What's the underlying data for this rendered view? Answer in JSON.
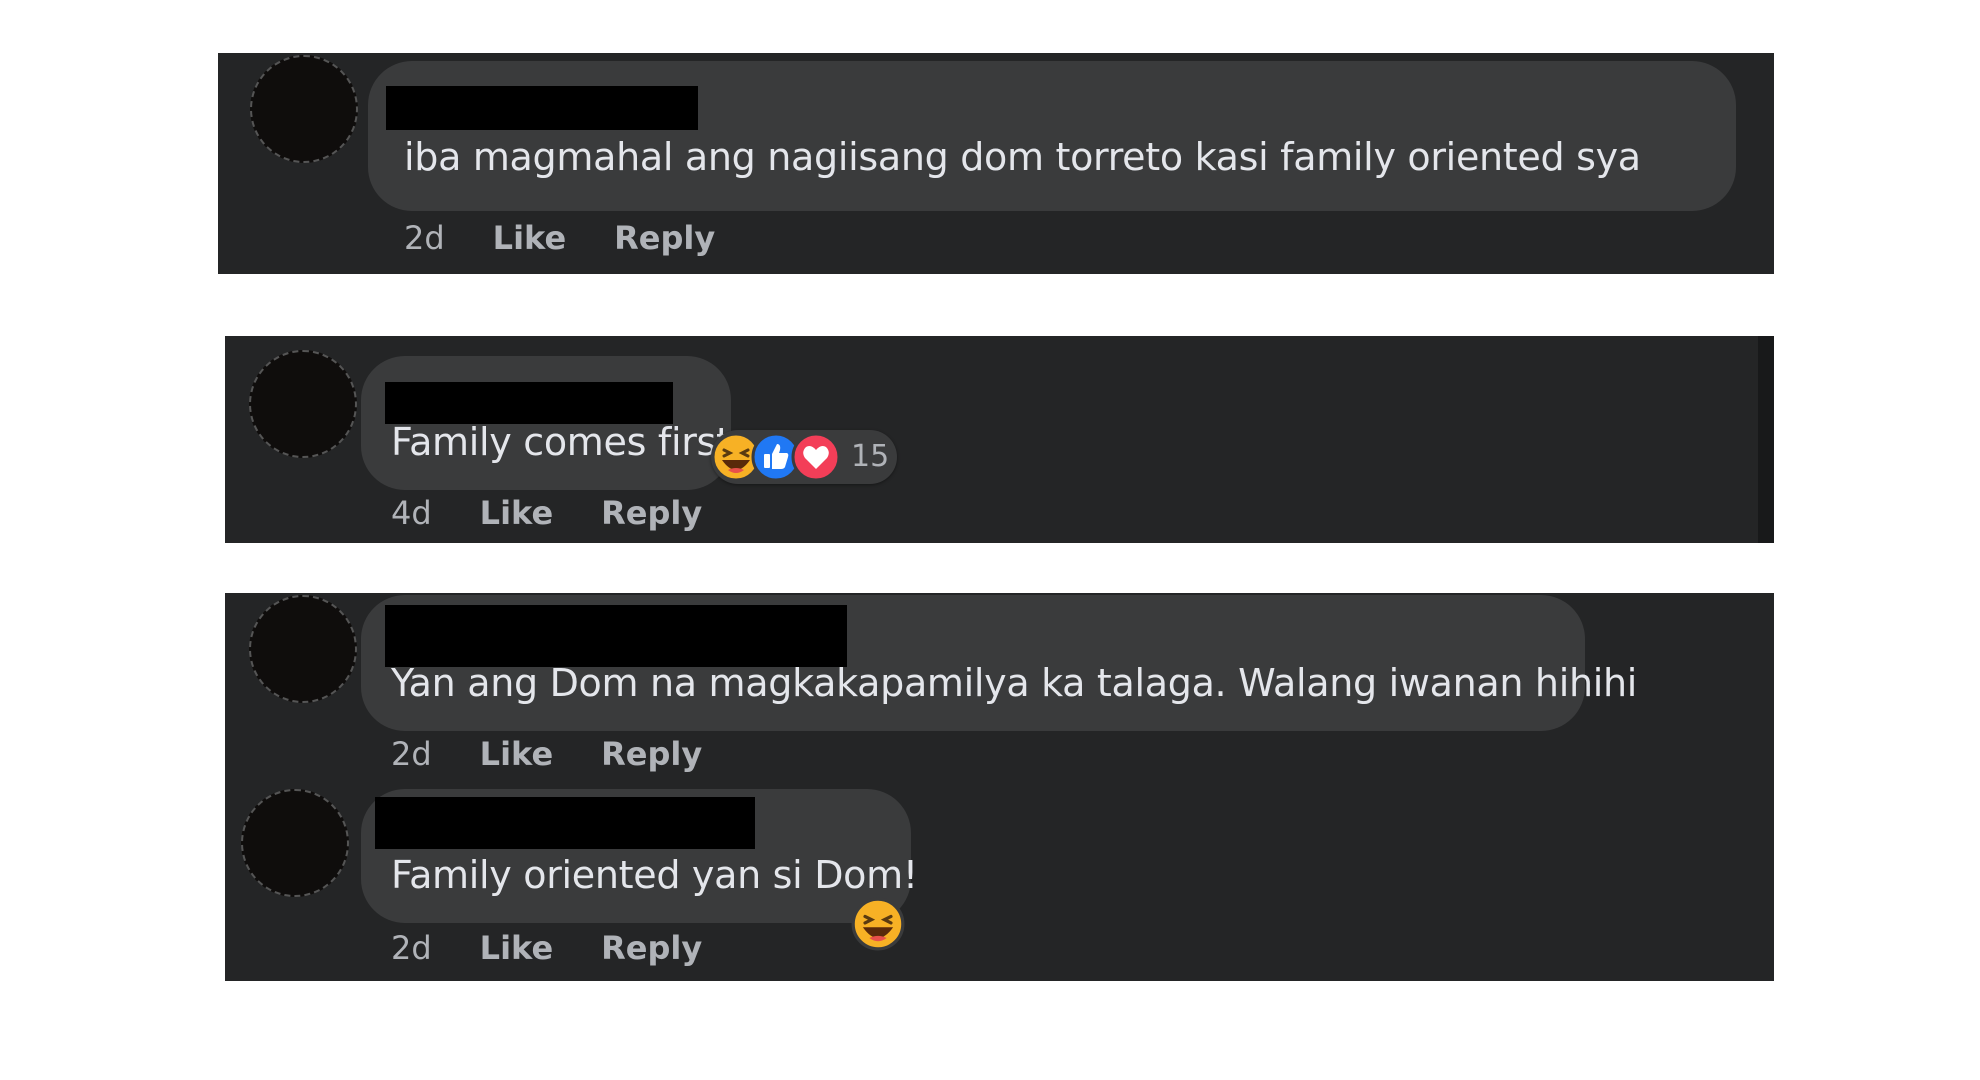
{
  "comments": [
    {
      "text": "iba magmahal ang nagiisang dom torreto kasi family oriented sya",
      "time": "2d",
      "like": "Like",
      "reply": "Reply"
    },
    {
      "text": "Family comes first",
      "time": "4d",
      "like": "Like",
      "reply": "Reply",
      "reactions": {
        "count": "15",
        "types": [
          "haha-icon",
          "like-icon",
          "love-icon"
        ]
      }
    },
    {
      "text": "Yan ang Dom na magkakapamilya ka talaga. Walang iwanan hihihi",
      "time": "2d",
      "like": "Like",
      "reply": "Reply"
    },
    {
      "text": "Family oriented yan si Dom!",
      "time": "2d",
      "like": "Like",
      "reply": "Reply",
      "reactions": {
        "types": [
          "haha-icon"
        ]
      }
    }
  ],
  "colors": {
    "panel": "#242526",
    "bubble": "#3a3b3c",
    "text": "#e4e6eb",
    "meta": "#b0b3b8",
    "like_blue": "#2078f4",
    "love_red": "#f33e58",
    "haha_yellow": "#f7b125"
  }
}
